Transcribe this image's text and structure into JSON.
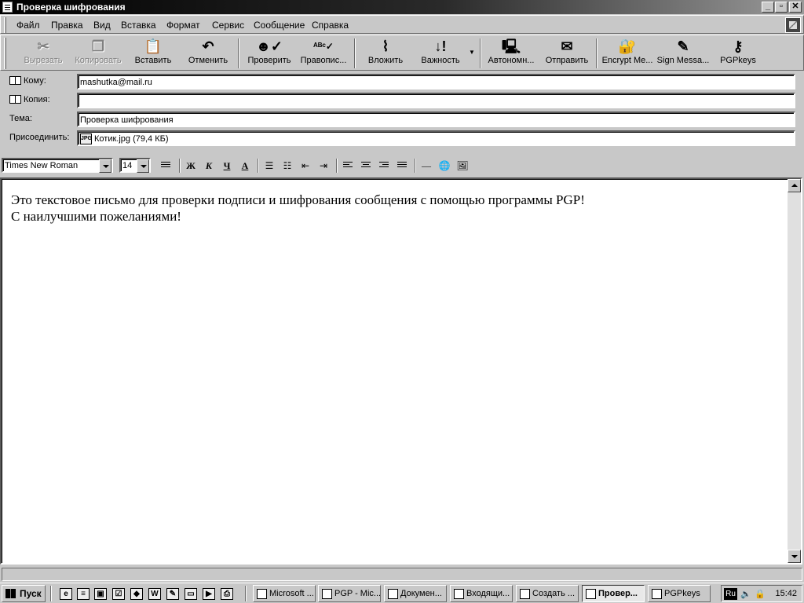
{
  "window": {
    "title": "Проверка шифрования"
  },
  "menu": [
    "Файл",
    "Правка",
    "Вид",
    "Вставка",
    "Формат",
    "Сервис",
    "Сообщение",
    "Справка"
  ],
  "toolbar": {
    "cut": "Вырезать",
    "copy": "Копировать",
    "paste": "Вставить",
    "undo": "Отменить",
    "check": "Проверить",
    "spelling": "Правопис...",
    "attach": "Вложить",
    "priority": "Важность",
    "offline": "Автономн...",
    "send": "Отправить",
    "encrypt": "Encrypt Me...",
    "sign": "Sign Messa...",
    "pgpkeys": "PGPkeys"
  },
  "header": {
    "to_label": "Кому:",
    "to_value": "mashutka@mail.ru",
    "cc_label": "Копия:",
    "cc_value": "",
    "subject_label": "Тема:",
    "subject_value": "Проверка шифрования",
    "attach_label": "Присоединить:",
    "attach_value": "Котик.jpg (79,4 КБ)",
    "attach_icon_text": "JPG"
  },
  "format": {
    "font": "Times New Roman",
    "size": "14",
    "bold": "Ж",
    "italic": "К",
    "underline": "Ч",
    "color": "A"
  },
  "body": {
    "line1": "Это текстовое письмо для проверки подписи и шифрования сообщения с помощью программы PGP!",
    "line2": "С наилучшими пожеланиями!"
  },
  "taskbar": {
    "start": "Пуск",
    "tasks": [
      "Microsoft ...",
      "PGP - Mic...",
      "Докумен...",
      "Входящи...",
      "Создать ...",
      "Провер...",
      "PGPkeys"
    ],
    "lang": "Ru",
    "clock": "15:42"
  }
}
